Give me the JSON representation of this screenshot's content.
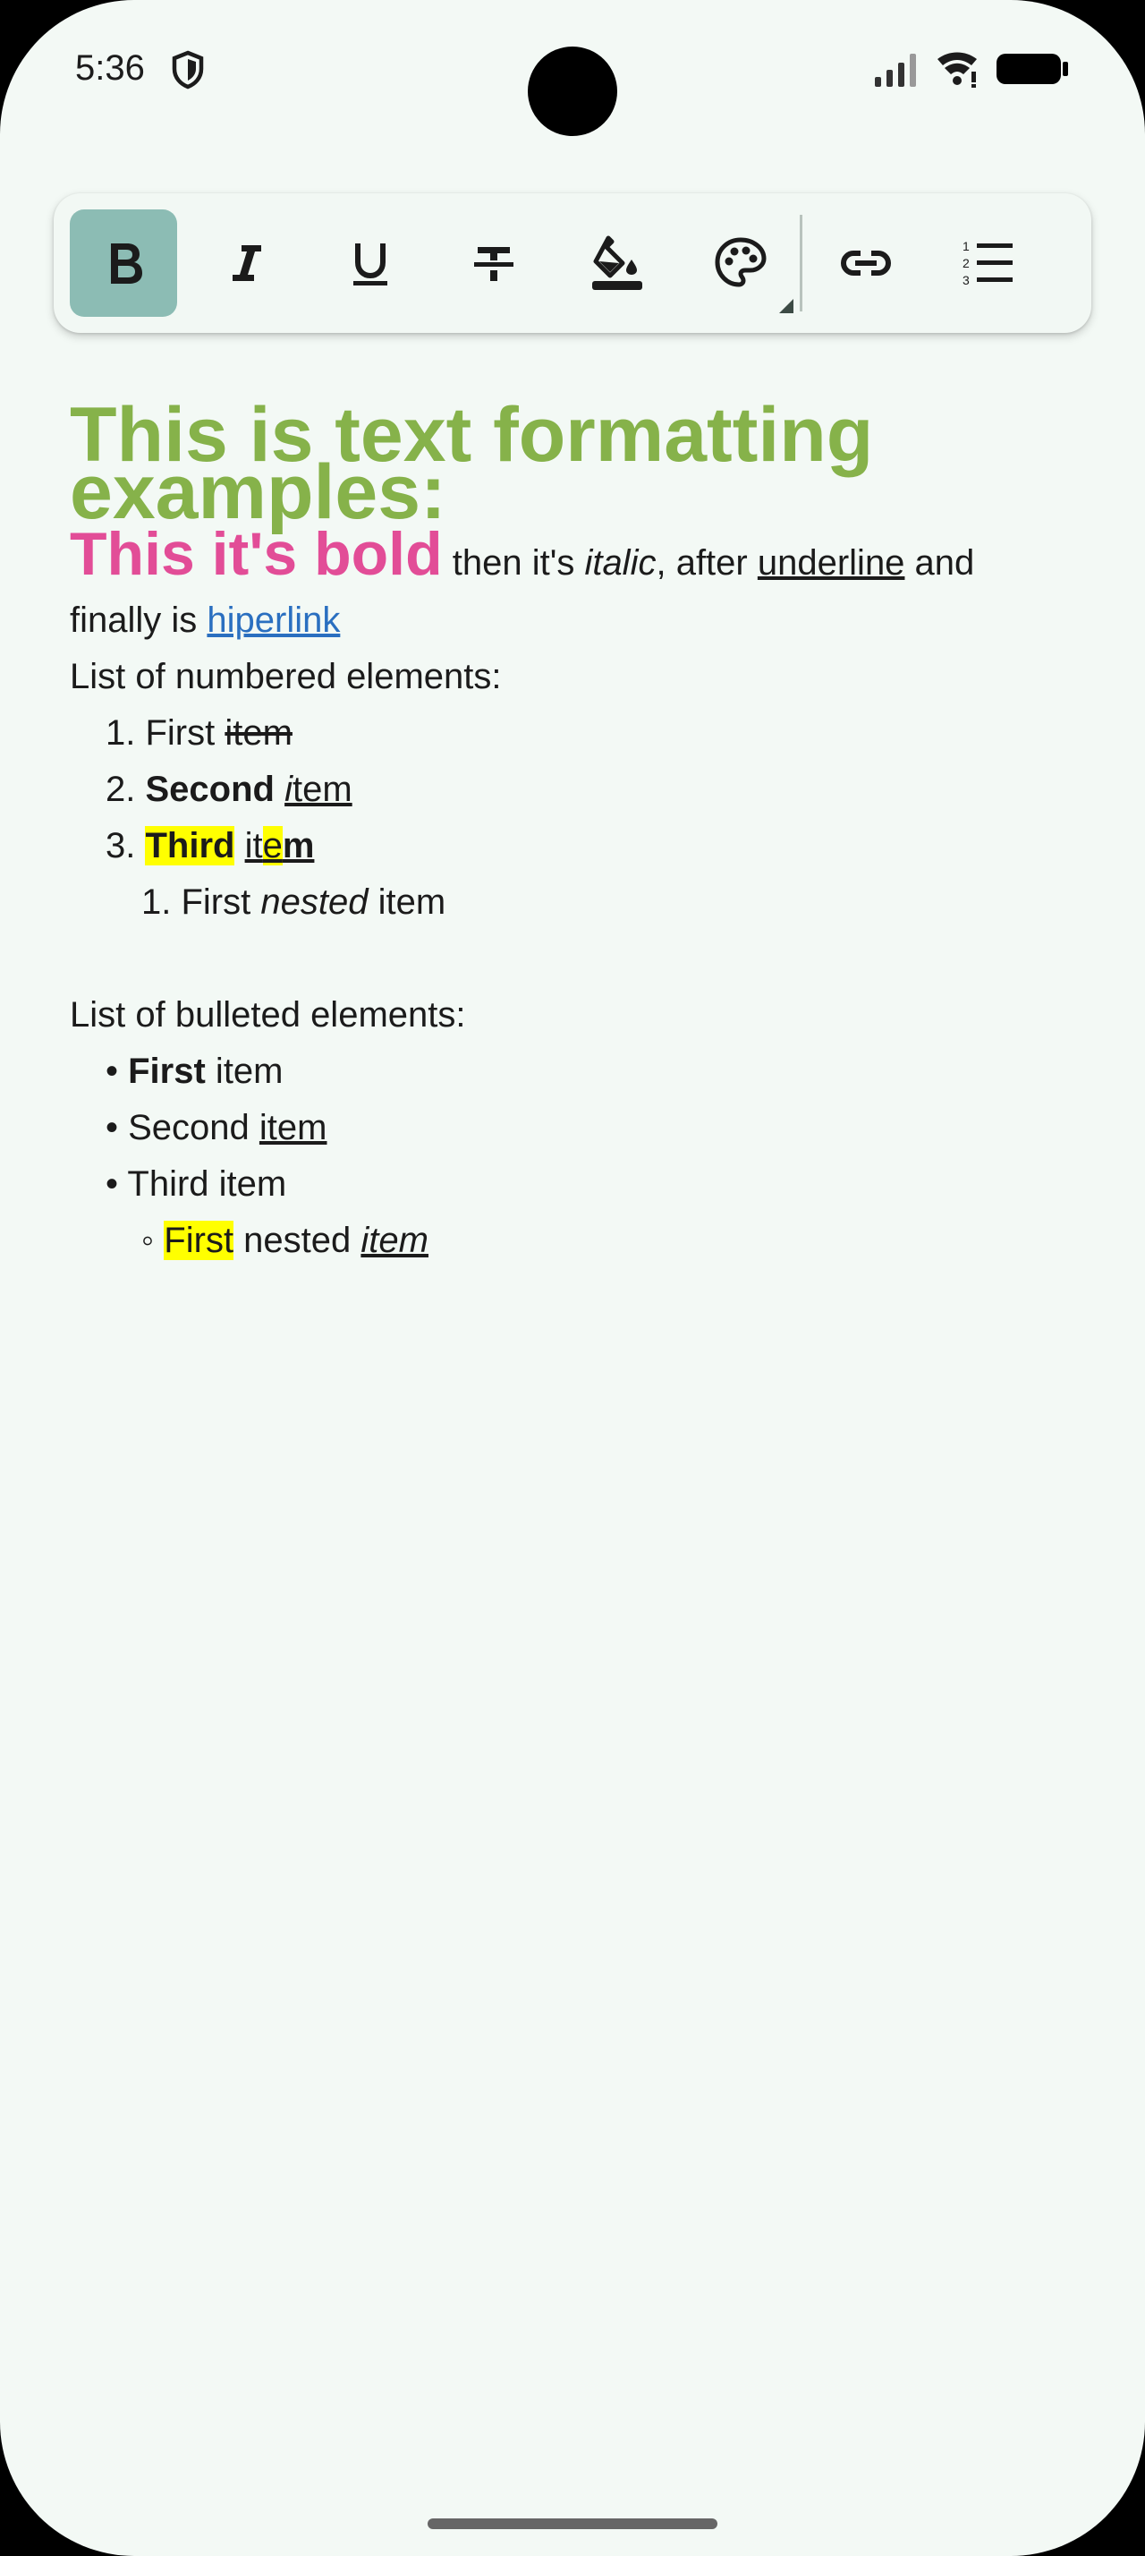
{
  "status_bar": {
    "time": "5:36",
    "icons": [
      "shield-icon",
      "signal-icon",
      "wifi-icon",
      "battery-icon"
    ]
  },
  "toolbar": {
    "buttons": [
      {
        "name": "bold",
        "icon": "bold-icon",
        "active": true
      },
      {
        "name": "italic",
        "icon": "italic-icon",
        "active": false
      },
      {
        "name": "underline",
        "icon": "underline-icon",
        "active": false
      },
      {
        "name": "strikethrough",
        "icon": "strikethrough-icon",
        "active": false
      },
      {
        "name": "highlight",
        "icon": "fill-bucket-icon",
        "active": false
      },
      {
        "name": "text-color",
        "icon": "palette-icon",
        "active": false
      },
      {
        "name": "link",
        "icon": "link-icon",
        "active": false
      },
      {
        "name": "numbered-list",
        "icon": "numbered-list-icon",
        "active": false
      },
      {
        "name": "more",
        "icon": "more-icon",
        "active": false
      }
    ],
    "active_color": "#8cbcb4"
  },
  "document": {
    "title_line1": "This is text formatting",
    "title_line2": "examples:",
    "p1": {
      "bold": "This it's bold",
      "t1": " then it's ",
      "italic": "italic",
      "t2": ", after ",
      "underline": "underline",
      "t3": " and"
    },
    "p2": {
      "t1": "finally is ",
      "link": "hiperlink"
    },
    "numbered_heading": "List of numbered elements:",
    "numbered": [
      {
        "marker": "1. ",
        "t1": "First ",
        "strike": "item"
      },
      {
        "marker": "2. ",
        "bold": "Second",
        "t1": " ",
        "italic_u": "i",
        "u": "tem"
      },
      {
        "marker": "3. ",
        "bold_hl": "Third",
        "t1": " ",
        "u1": "it",
        "u_hl": "e",
        "u_b": "m"
      },
      {
        "marker": "1. ",
        "t1": "First ",
        "italic": "nested",
        "t2": " item"
      }
    ],
    "bulleted_heading": "List of bulleted elements:",
    "bulleted": [
      {
        "marker": "• ",
        "bold": "First",
        "t1": " item"
      },
      {
        "marker": "• ",
        "t1": "Second ",
        "u": "item"
      },
      {
        "marker": "• ",
        "t1": "Third item"
      },
      {
        "marker": "◦ ",
        "hl": "First",
        "t1": " nested ",
        "iu": "item"
      }
    ]
  },
  "colors": {
    "background": "#f3f9f5",
    "title_green": "#86b24a",
    "bold_pink": "#e24d97",
    "link_blue": "#2a6fc0",
    "highlight_yellow": "#ffff00"
  }
}
